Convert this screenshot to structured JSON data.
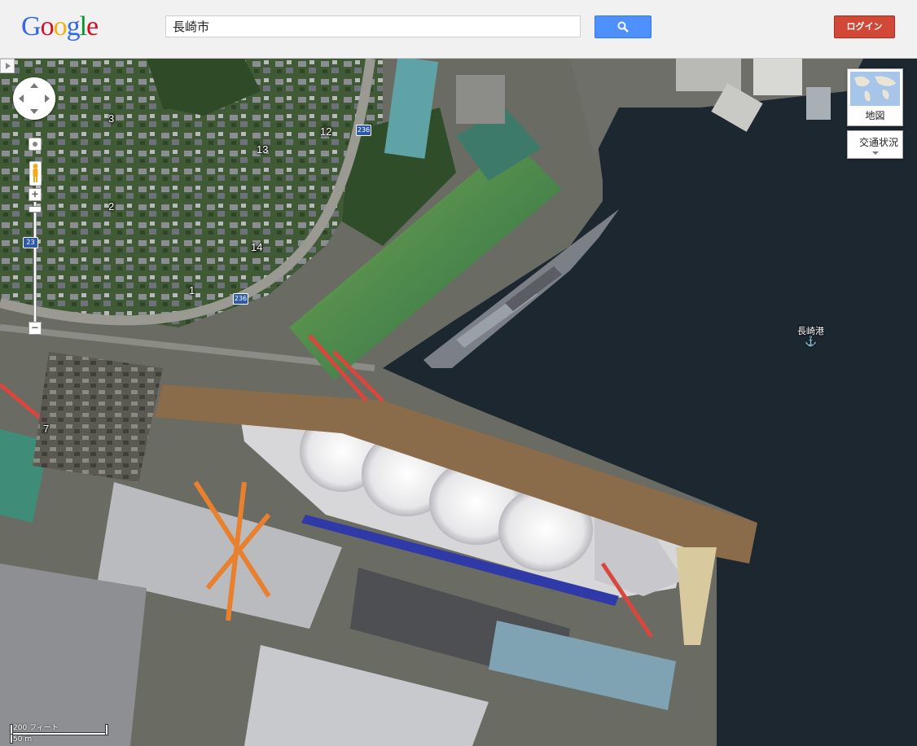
{
  "header": {
    "logo_letters": [
      {
        "ch": "G",
        "color": "#3369e8"
      },
      {
        "ch": "o",
        "color": "#d50f25"
      },
      {
        "ch": "o",
        "color": "#eeb211"
      },
      {
        "ch": "g",
        "color": "#3369e8"
      },
      {
        "ch": "l",
        "color": "#009925"
      },
      {
        "ch": "e",
        "color": "#d50f25"
      }
    ],
    "search_value": "長崎市",
    "search_icon": "magnifier-icon",
    "login_label": "ログイン",
    "login_color": "#d14836",
    "search_button_color": "#4d90fe"
  },
  "map_controls": {
    "map_type_label": "地図",
    "traffic_label": "交通状況"
  },
  "map": {
    "place_label": "長崎港",
    "place_icon": "anchor-icon",
    "road_numbers": [
      "3",
      "12",
      "13",
      "2",
      "14",
      "1",
      "7"
    ],
    "route_shields": [
      "236",
      "23",
      "236"
    ],
    "scale_imperial": "200 フィート",
    "scale_metric": "50 m"
  }
}
